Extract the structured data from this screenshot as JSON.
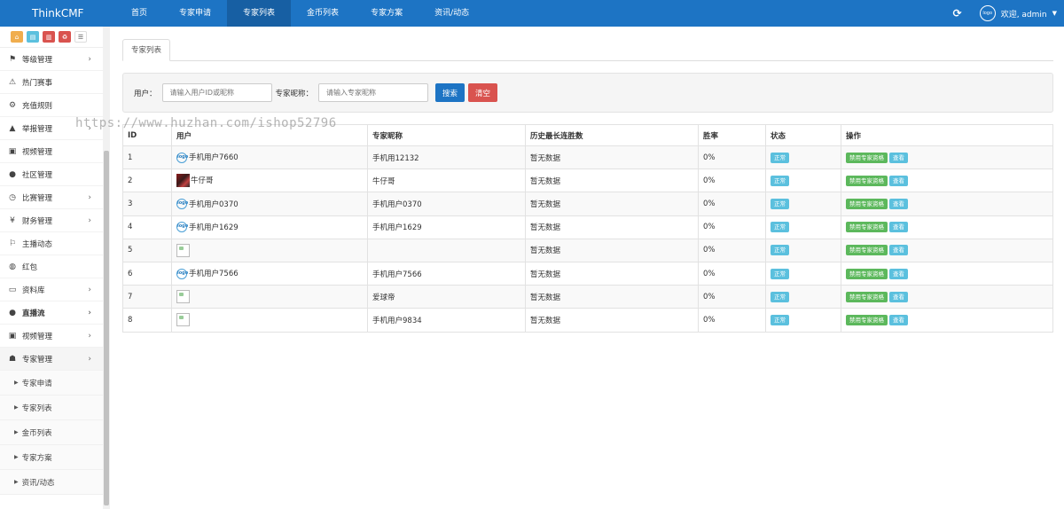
{
  "brand": "ThinkCMF",
  "topnav": [
    {
      "label": "首页",
      "active": false
    },
    {
      "label": "专家申请",
      "active": false
    },
    {
      "label": "专家列表",
      "active": true
    },
    {
      "label": "金币列表",
      "active": false
    },
    {
      "label": "专家方案",
      "active": false
    },
    {
      "label": "资讯/动态",
      "active": false
    }
  ],
  "user": {
    "welcome": "欢迎, admin",
    "avatar_text": "logo"
  },
  "sidebar": {
    "shortcuts": [
      "home-icon",
      "doc-icon",
      "trash-icon",
      "recycle-icon",
      "list-icon"
    ],
    "items": [
      {
        "label": "等级管理",
        "icon": "sitemap-icon",
        "glyph": "⚑",
        "chevron": true
      },
      {
        "label": "热门赛事",
        "icon": "hot-icon",
        "glyph": "⚠",
        "chevron": false
      },
      {
        "label": "充值规则",
        "icon": "cogs-icon",
        "glyph": "⚙",
        "chevron": false
      },
      {
        "label": "举报管理",
        "icon": "warning-icon",
        "glyph": "▲",
        "chevron": true
      },
      {
        "label": "视频管理",
        "icon": "file-icon",
        "glyph": "▣",
        "chevron": false
      },
      {
        "label": "社区管理",
        "icon": "comment-icon",
        "glyph": "●",
        "chevron": false
      },
      {
        "label": "比赛管理",
        "icon": "clock-icon",
        "glyph": "◷",
        "chevron": true
      },
      {
        "label": "财务管理",
        "icon": "yen-icon",
        "glyph": "¥",
        "chevron": true
      },
      {
        "label": "主播动态",
        "icon": "flag-icon",
        "glyph": "⚐",
        "chevron": false
      },
      {
        "label": "红包",
        "icon": "globe-icon",
        "glyph": "◍",
        "chevron": false
      },
      {
        "label": "资料库",
        "icon": "monitor-icon",
        "glyph": "▭",
        "chevron": true
      },
      {
        "label": "直播流",
        "icon": "tint-icon",
        "glyph": "●",
        "chevron": true,
        "bold": true
      },
      {
        "label": "视频管理",
        "icon": "file-icon",
        "glyph": "▣",
        "chevron": true
      },
      {
        "label": "专家管理",
        "icon": "user-plus-icon",
        "glyph": "☗",
        "chevron": true,
        "open": true
      }
    ],
    "sub_items": [
      "专家申请",
      "专家列表",
      "金币列表",
      "专家方案",
      "资讯/动态"
    ]
  },
  "main": {
    "tab_label": "专家列表",
    "filter": {
      "user_label": "用户：",
      "user_placeholder": "请输入用户ID或昵称",
      "nick_label": "专家昵称：",
      "nick_placeholder": "请输入专家昵称",
      "search_label": "搜索",
      "clear_label": "清空"
    },
    "watermark": "https://www.huzhan.com/ishop52796",
    "table": {
      "headers": [
        "ID",
        "用户",
        "专家昵称",
        "历史最长连胜数",
        "胜率",
        "状态",
        "操作"
      ],
      "rows": [
        {
          "id": "1",
          "avatar": "logo",
          "user": "手机用户7660",
          "nick": "手机用12132",
          "streak": "暂无数据",
          "rate": "0%",
          "status": "正常"
        },
        {
          "id": "2",
          "avatar": "photo",
          "user": "牛仔哥",
          "nick": "牛仔哥",
          "streak": "暂无数据",
          "rate": "0%",
          "status": "正常"
        },
        {
          "id": "3",
          "avatar": "logo",
          "user": "手机用户0370",
          "nick": "手机用户0370",
          "streak": "暂无数据",
          "rate": "0%",
          "status": "正常"
        },
        {
          "id": "4",
          "avatar": "logo",
          "user": "手机用户1629",
          "nick": "手机用户1629",
          "streak": "暂无数据",
          "rate": "0%",
          "status": "正常"
        },
        {
          "id": "5",
          "avatar": "broken",
          "user": "",
          "nick": "",
          "streak": "暂无数据",
          "rate": "0%",
          "status": "正常"
        },
        {
          "id": "6",
          "avatar": "logo",
          "user": "手机用户7566",
          "nick": "手机用户7566",
          "streak": "暂无数据",
          "rate": "0%",
          "status": "正常"
        },
        {
          "id": "7",
          "avatar": "broken",
          "user": "",
          "nick": "爱球帝",
          "streak": "暂无数据",
          "rate": "0%",
          "status": "正常"
        },
        {
          "id": "8",
          "avatar": "broken",
          "user": "",
          "nick": "手机用户9834",
          "streak": "暂无数据",
          "rate": "0%",
          "status": "正常"
        }
      ],
      "actions": {
        "disable": "禁用专家资格",
        "view": "查看"
      }
    }
  },
  "colors": {
    "topbar": "#1d74c4",
    "primary": "#1d74c4",
    "danger": "#d9534f",
    "success": "#5cb85c",
    "info": "#5bc0de"
  }
}
